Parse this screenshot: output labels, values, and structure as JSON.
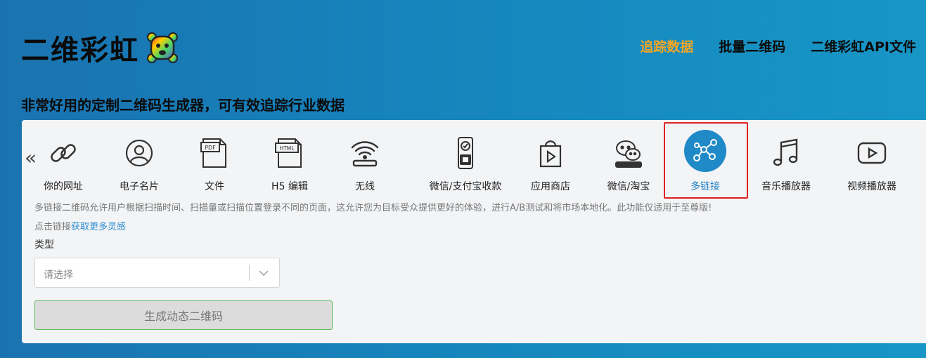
{
  "brand": {
    "title": "二维彩虹"
  },
  "nav": [
    {
      "label": "追踪数据",
      "active": true
    },
    {
      "label": "批量二维码",
      "active": false
    },
    {
      "label": "二维彩虹API文件",
      "active": false
    }
  ],
  "tagline": "非常好用的定制二维码生成器，可有效追踪行业数据",
  "tools": [
    {
      "label": "你的网址",
      "icon": "link-icon"
    },
    {
      "label": "电子名片",
      "icon": "user-icon"
    },
    {
      "label": "文件",
      "icon": "pdf-file-icon",
      "badge": "PDF"
    },
    {
      "label": "H5 编辑",
      "icon": "html-file-icon",
      "badge": "HTML"
    },
    {
      "label": "无线",
      "icon": "wifi-icon"
    },
    {
      "label": "微信/支付宝收款",
      "icon": "payment-icon"
    },
    {
      "label": "应用商店",
      "icon": "app-store-icon"
    },
    {
      "label": "微信/淘宝",
      "icon": "wechat-icon"
    },
    {
      "label": "多链接",
      "icon": "multi-link-icon",
      "active": true
    },
    {
      "label": "音乐播放器",
      "icon": "music-icon"
    },
    {
      "label": "视频播放器",
      "icon": "video-icon"
    }
  ],
  "description": "多链接二维码允许用户根据扫描时间、扫描量或扫描位置登录不同的页面，这允许您为目标受众提供更好的体验，进行A/B测试和将市场本地化。此功能仅适用于至尊版!",
  "tip": {
    "prefix": "点击链接",
    "link": "获取更多灵感"
  },
  "form": {
    "type_label": "类型",
    "select_placeholder": "请选择",
    "generate_label": "生成动态二维码"
  },
  "colors": {
    "accent": "#f5a623",
    "primary": "#2089c7",
    "highlight": "#e02020"
  }
}
